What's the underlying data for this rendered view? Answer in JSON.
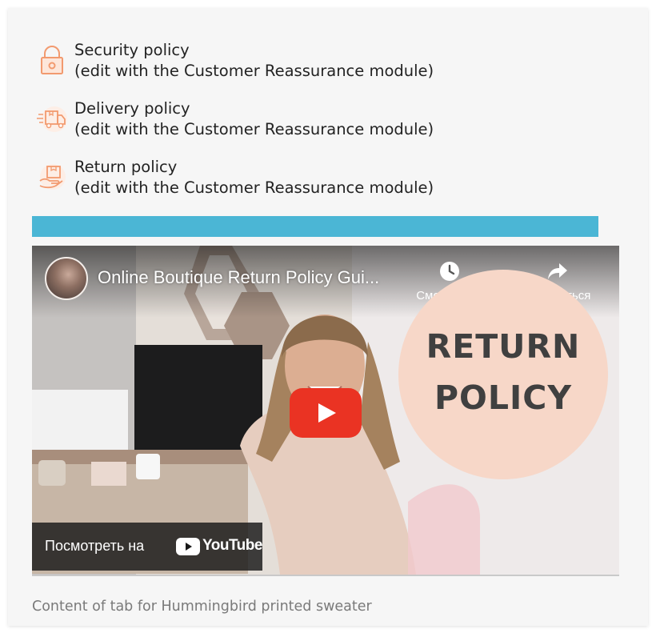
{
  "reassurance": {
    "items": [
      {
        "icon": "lock-icon",
        "title": "Security policy",
        "subtitle": "(edit with the Customer Reassurance module)"
      },
      {
        "icon": "delivery-truck-icon",
        "title": "Delivery policy",
        "subtitle": "(edit with the Customer Reassurance module)"
      },
      {
        "icon": "return-box-icon",
        "title": "Return policy",
        "subtitle": "(edit with the Customer Reassurance module)"
      }
    ],
    "icon_color": "#f29a6f"
  },
  "accent_bar_color": "#4bb6d5",
  "video": {
    "title": "Online Boutique Return Policy Gui...",
    "watch_later_label": "Смотреть ...",
    "share_label": "Поделиться",
    "overlay_heading_line1": "RETURN",
    "overlay_heading_line2": "POLICY",
    "watch_on_label": "Посмотреть на",
    "platform_name": "YouTube",
    "play_button_color": "#ea3323"
  },
  "tab_content_text": "Content of tab for Hummingbird printed sweater"
}
